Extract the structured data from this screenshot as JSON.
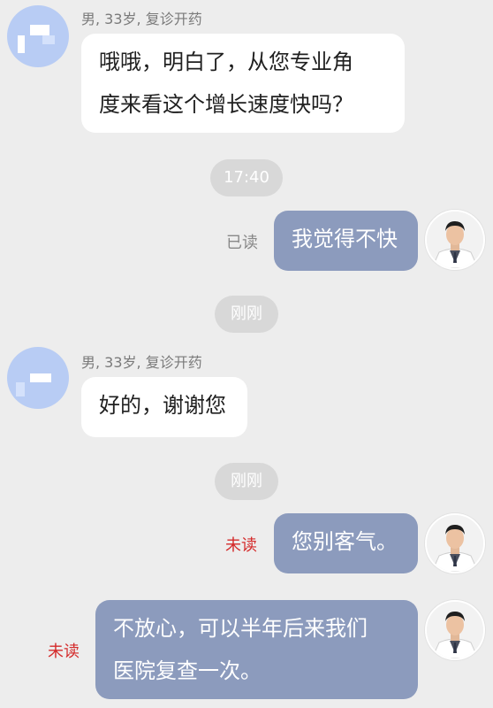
{
  "messages": {
    "m1": {
      "sender_info": "男, 33岁, 复诊开药",
      "text_line1": "哦哦，明白了，从您专业角",
      "text_line2": "度来看这个增长速度快吗？"
    },
    "time1": "17:40",
    "m2": {
      "text": "我觉得不快",
      "status": "已读"
    },
    "time2": "刚刚",
    "m3": {
      "sender_info": "男, 33岁, 复诊开药",
      "text": "好的，谢谢您"
    },
    "time3": "刚刚",
    "m4": {
      "text": "您别客气。",
      "status": "未读"
    },
    "m5": {
      "text_line1": "不放心，可以半年后来我们",
      "text_line2": "医院复查一次。",
      "status": "未读"
    }
  },
  "colors": {
    "background": "#ededed",
    "outgoing_bubble": "#8c9bbd",
    "incoming_bubble": "#ffffff",
    "unread": "#d42a2a"
  }
}
